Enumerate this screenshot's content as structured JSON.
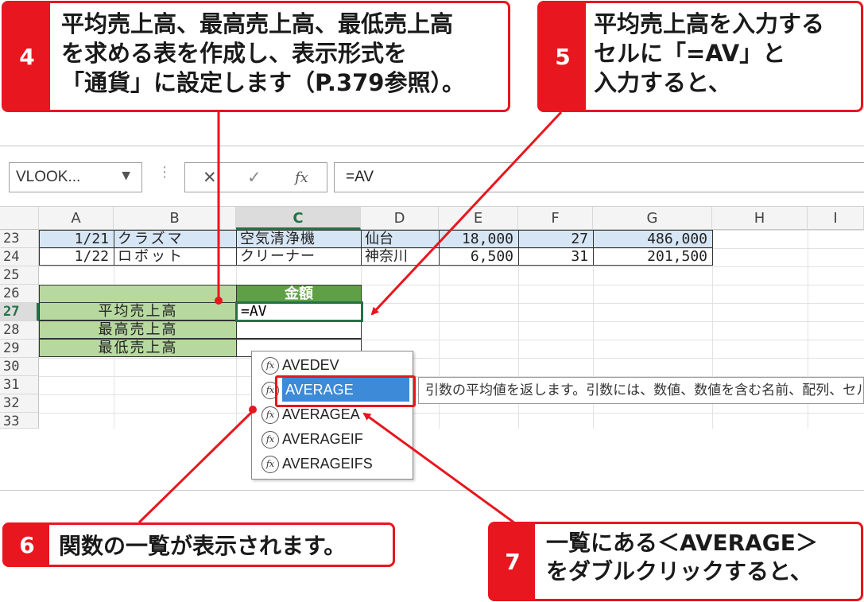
{
  "callouts": {
    "c4": {
      "number": "4",
      "text": "平均売上高、最高売上高、最低売上高\nを求める表を作成し、表示形式を\n「通貨」に設定します（P.379参照）。"
    },
    "c5": {
      "number": "5",
      "text": "平均売上高を入力する\nセルに「=AV」と\n入力すると、"
    },
    "c6": {
      "number": "6",
      "text": "関数の一覧が表示されます。"
    },
    "c7": {
      "number": "7",
      "text": "一覧にある＜AVERAGE＞\nをダブルクリックすると、"
    }
  },
  "formula_bar": {
    "name_box": "VLOOK...",
    "cancel_icon": "✕",
    "enter_icon": "✓",
    "fx_label": "fx",
    "formula": "=AV"
  },
  "columns": [
    "A",
    "B",
    "C",
    "D",
    "E",
    "F",
    "G",
    "H",
    "I"
  ],
  "rows": [
    "23",
    "24",
    "25",
    "26",
    "27",
    "28",
    "29",
    "30",
    "31",
    "32",
    "33"
  ],
  "data_rows": [
    {
      "date": "1/21",
      "name": "クラズマ",
      "product": "空気清浄機",
      "city": "仙台",
      "price": "18,000",
      "qty": "27",
      "amount": "486,000"
    },
    {
      "date": "1/22",
      "name": "ロボット",
      "product": "クリーナー",
      "city": "神奈川",
      "price": "6,500",
      "qty": "31",
      "amount": "201,500"
    }
  ],
  "summary": {
    "header": "金額",
    "labels": [
      "平均売上高",
      "最高売上高",
      "最低売上高"
    ],
    "active_input": "=AV"
  },
  "autocomplete": {
    "items": [
      "AVEDEV",
      "AVERAGE",
      "AVERAGEA",
      "AVERAGEIF",
      "AVERAGEIFS"
    ],
    "selected": "AVERAGE",
    "tooltip": "引数の平均値を返します。引数には、数値、数値を含む名前、配列、セル参照を指定できます。"
  },
  "colors": {
    "accent_red": "#e8161e",
    "excel_green": "#217346",
    "table_green": "#b7d9a0",
    "header_green": "#5fa046",
    "row_blue": "#d7e6f4"
  }
}
